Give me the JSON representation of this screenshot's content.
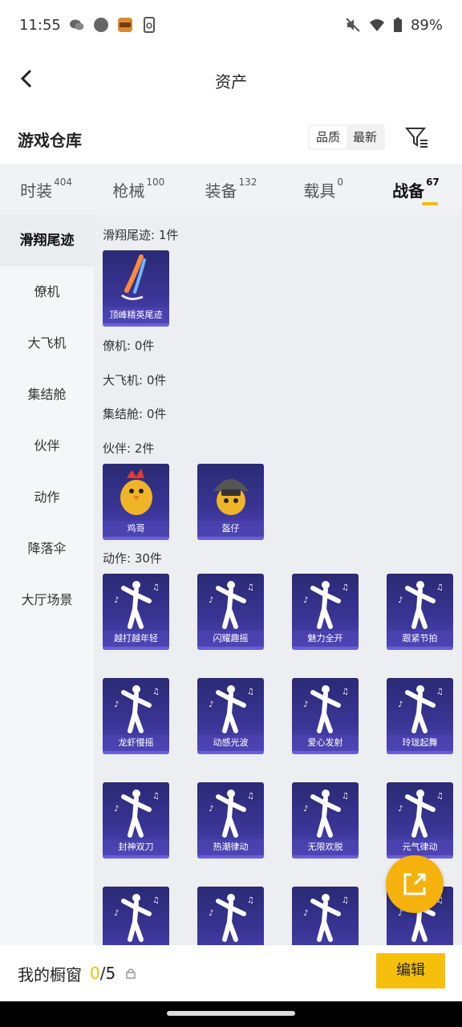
{
  "status": {
    "time": "11:55",
    "battery": "89%"
  },
  "appbar": {
    "title": "资产"
  },
  "warehouse": {
    "title": "游戏仓库",
    "sort_quality": "品质",
    "sort_latest": "最新"
  },
  "tabs": [
    {
      "label": "时装",
      "count": "404"
    },
    {
      "label": "枪械",
      "count": "100"
    },
    {
      "label": "装备",
      "count": "132"
    },
    {
      "label": "载具",
      "count": "0"
    },
    {
      "label": "战备",
      "count": "67"
    }
  ],
  "sidebar": [
    "滑翔尾迹",
    "僚机",
    "大飞机",
    "集结舱",
    "伙伴",
    "动作",
    "降落伞",
    "大厅场景"
  ],
  "sections": {
    "trail": {
      "title": "滑翔尾迹: 1件",
      "items": [
        "顶峰精英尾迹"
      ]
    },
    "wingman": {
      "title": "僚机: 0件"
    },
    "plane": {
      "title": "大飞机: 0件"
    },
    "pod": {
      "title": "集结舱: 0件"
    },
    "partner": {
      "title": "伙伴: 2件",
      "items": [
        "鸡哥",
        "盔仔"
      ]
    },
    "emote": {
      "title": "动作: 30件",
      "items": [
        "越打越年轻",
        "闪耀趣摇",
        "魅力全开",
        "跟紧节拍",
        "龙虾慢摇",
        "动感光波",
        "爱心发射",
        "玲珑起舞",
        "封神双刀",
        "热潮律动",
        "无限欢脱",
        "元气律动",
        "",
        "",
        "",
        ""
      ]
    }
  },
  "showcase": {
    "label": "我的橱窗",
    "current": "0",
    "total": "/5",
    "edit": "编辑"
  },
  "icons": {
    "back": "chevron-left-icon",
    "filter": "filter-icon",
    "share": "external-link-icon",
    "lock": "lock-icon"
  },
  "colors": {
    "accent": "#f5bf0b",
    "card": "#3a3596"
  }
}
